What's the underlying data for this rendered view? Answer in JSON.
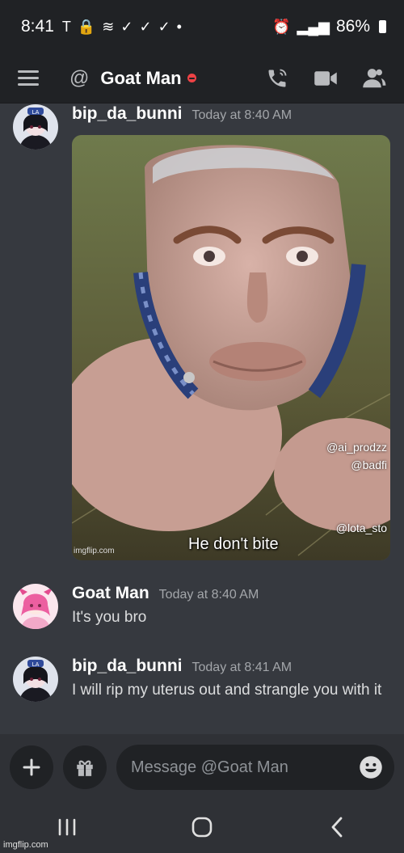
{
  "status_bar": {
    "time": "8:41",
    "battery": "86%"
  },
  "header": {
    "channel_name": "Goat Man",
    "status_color": "#ed4245"
  },
  "messages": [
    {
      "username": "bip_da_bunni",
      "timestamp": "Today at 8:40 AM",
      "attachment": {
        "caption": "He don't bite",
        "watermark_1": "@ai_prodzz",
        "watermark_2": "@badfi",
        "watermark_3": "@lota_sto",
        "source": "imgflip.com"
      }
    },
    {
      "username": "Goat Man",
      "timestamp": "Today at 8:40 AM",
      "text": "It's you bro"
    },
    {
      "username": "bip_da_bunni",
      "timestamp": "Today at 8:41 AM",
      "text": "I will rip my uterus out and strangle you with it"
    }
  ],
  "composer": {
    "placeholder": "Message @Goat Man"
  },
  "footer": {
    "watermark": "imgflip.com"
  },
  "colors": {
    "background": "#36393f",
    "header": "#202225",
    "text": "#dcddde"
  }
}
